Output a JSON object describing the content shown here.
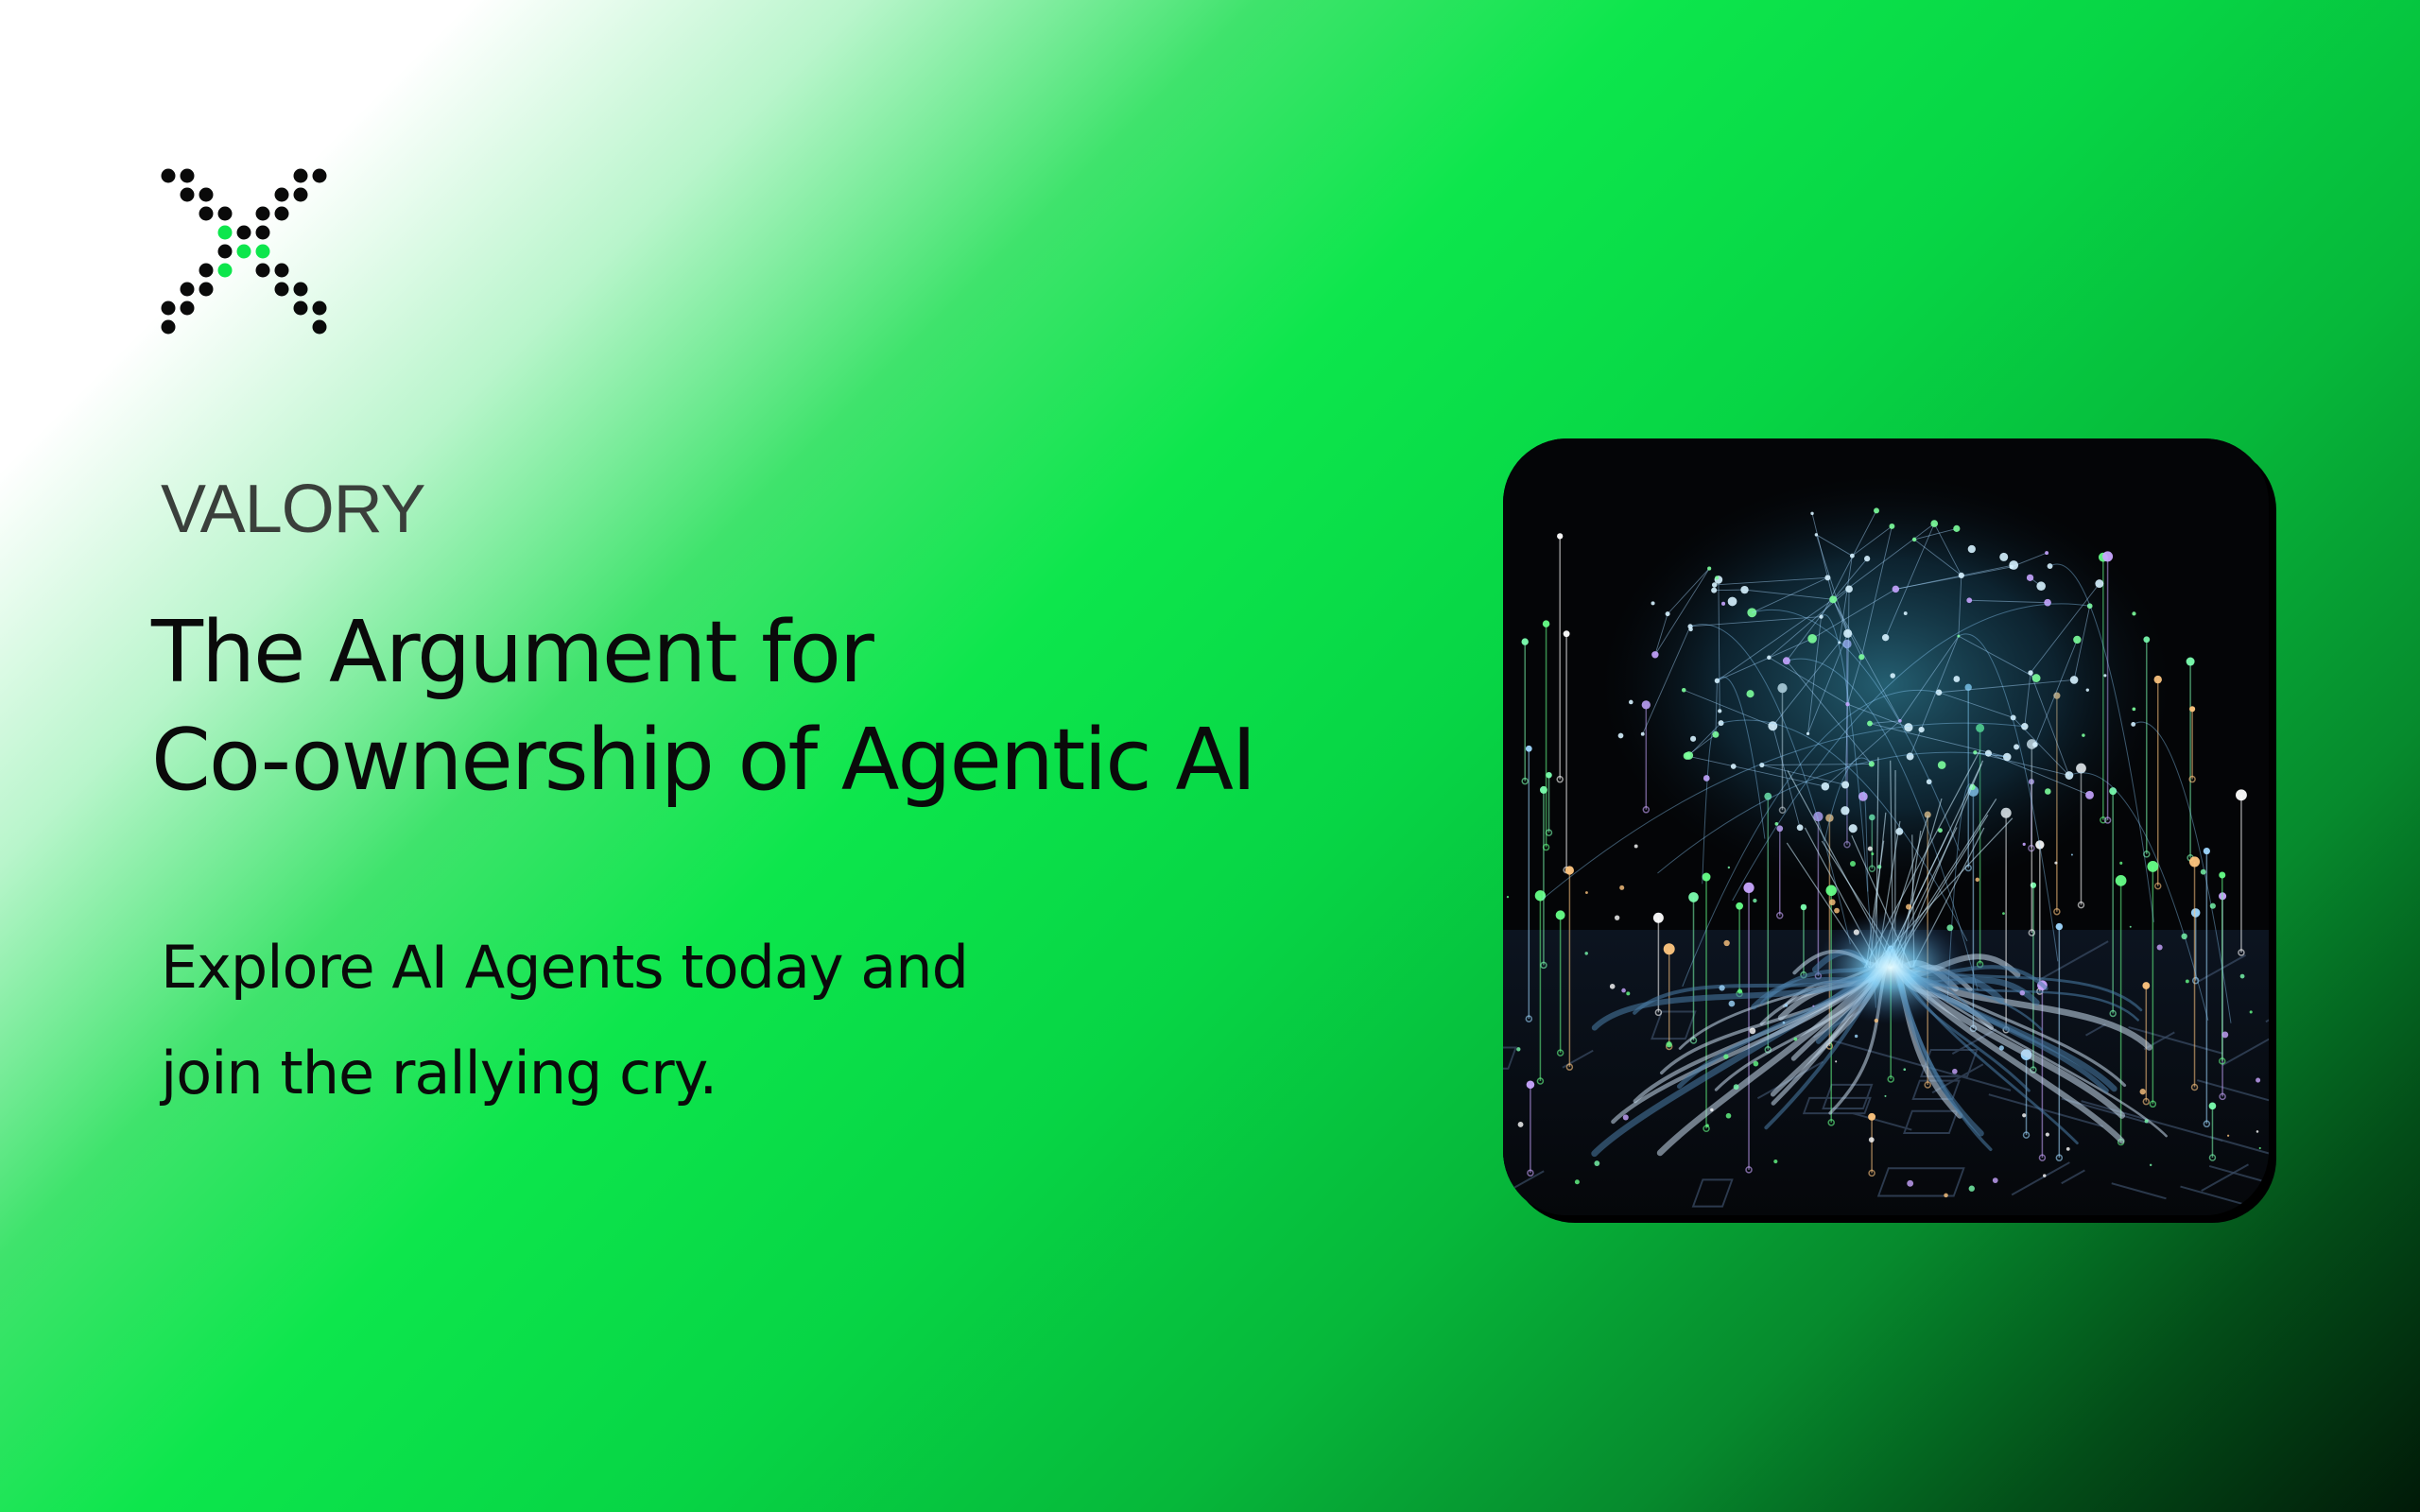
{
  "brand": {
    "name": "VALORY",
    "logo_icon": "dotted-x-logo-icon",
    "accent_color": "#0de64c"
  },
  "hero": {
    "headline_lines": [
      "The Argument for",
      "Co-ownership of Agentic AI"
    ],
    "subline_lines": [
      "Explore AI Agents today and",
      "join the rallying cry."
    ]
  },
  "artwork": {
    "icon": "neural-network-tree-illustration"
  }
}
